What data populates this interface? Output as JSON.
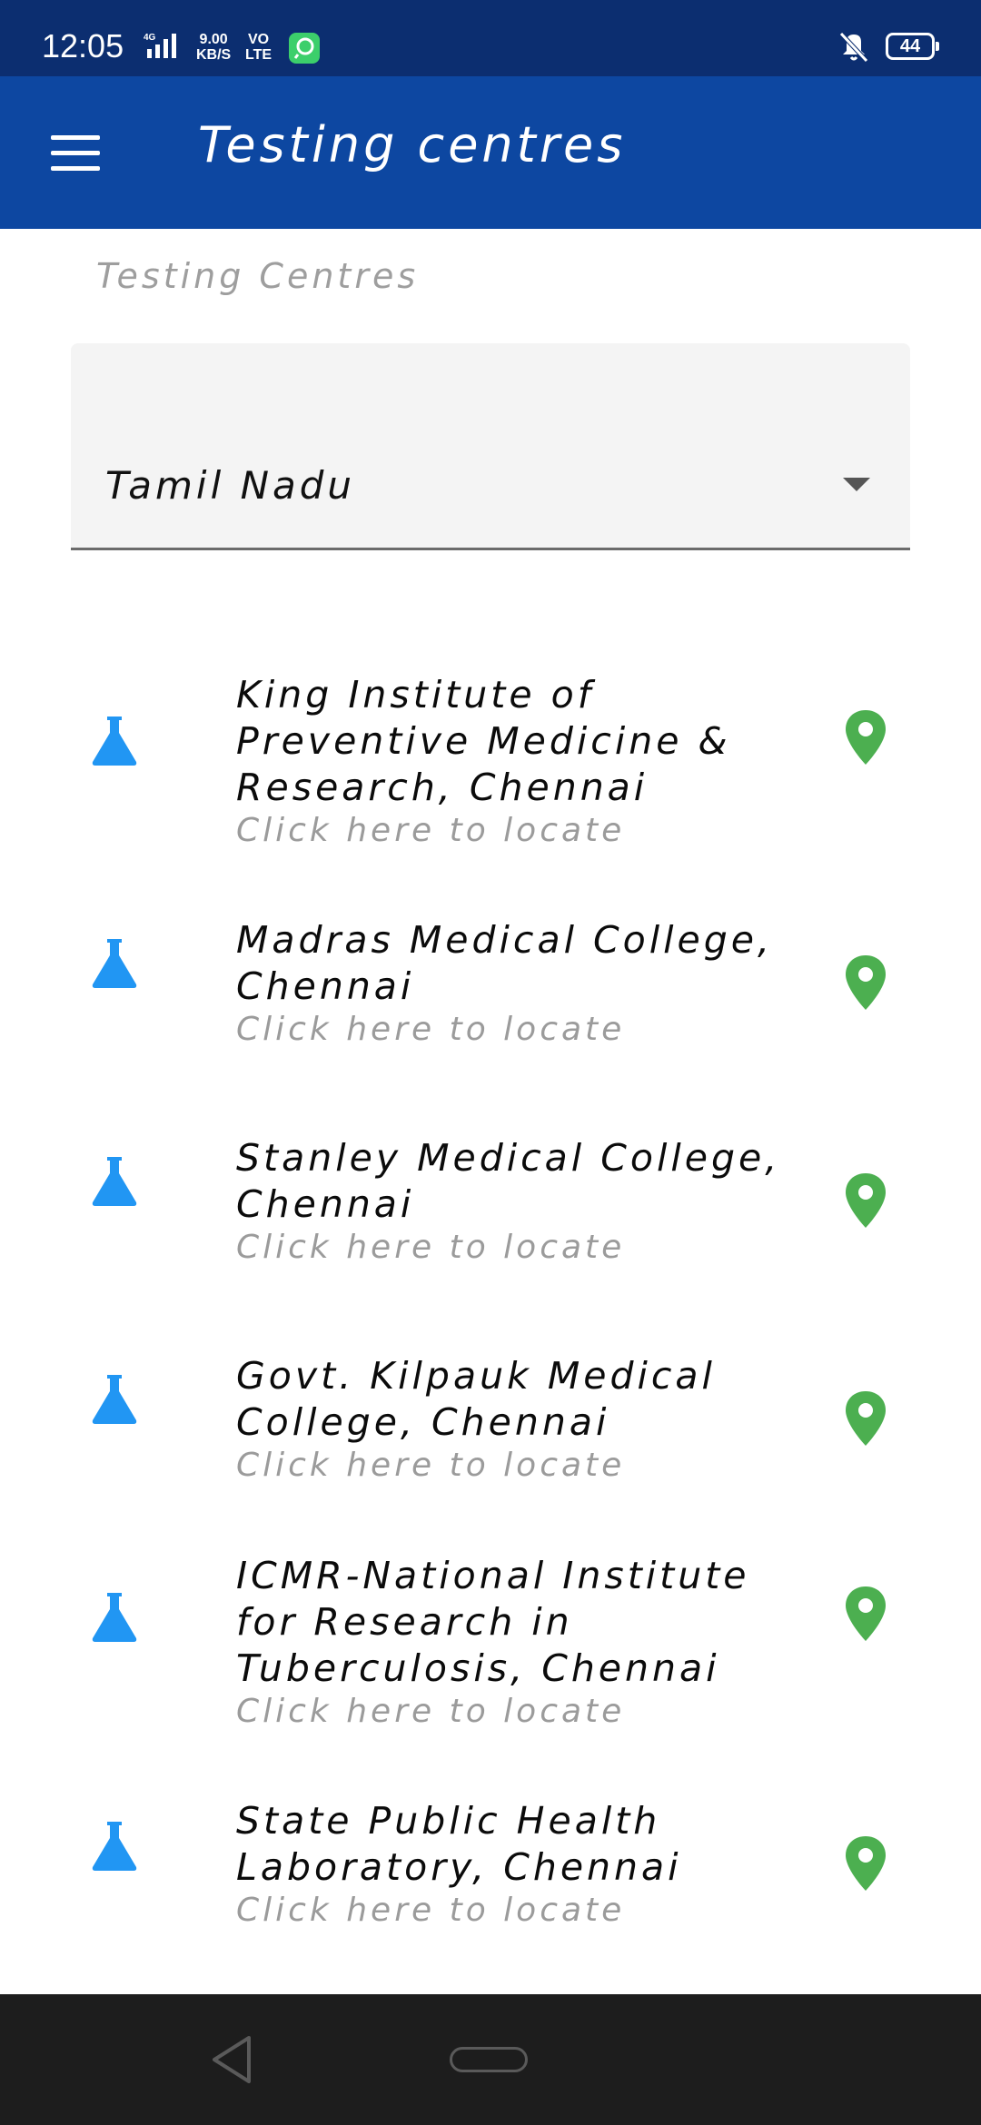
{
  "status_bar": {
    "time": "12:05",
    "network": "4G",
    "speed_value": "9.00",
    "speed_unit": "KB/S",
    "volte_top": "VO",
    "volte_bottom": "LTE",
    "battery": "44"
  },
  "app_bar": {
    "title": "Testing centres",
    "menu_icon": "hamburger-menu-icon",
    "color": "#0d47a1"
  },
  "section": {
    "label": "Testing Centres"
  },
  "state_select": {
    "value": "Tamil Nadu"
  },
  "centres": [
    {
      "name": "King Institute of Preventive Medicine & Research, Chennai",
      "action": "Click here to locate"
    },
    {
      "name": "Madras Medical College, Chennai",
      "action": "Click here to locate"
    },
    {
      "name": "Stanley Medical College, Chennai",
      "action": "Click here to locate"
    },
    {
      "name": "Govt. Kilpauk Medical College, Chennai",
      "action": "Click here to locate"
    },
    {
      "name": "ICMR-National Institute for Research in Tuberculosis, Chennai",
      "action": "Click here to locate"
    },
    {
      "name": "State Public Health Laboratory, Chennai",
      "action": "Click here to locate"
    }
  ],
  "colors": {
    "status_bar": "#0c2e70",
    "flask_icon": "#2196f3",
    "pin_icon": "#4caf50",
    "nav_bar": "#1d1d1d"
  },
  "icons": {
    "centre_icon": "flask-icon",
    "locate_icon": "map-pin-icon"
  }
}
